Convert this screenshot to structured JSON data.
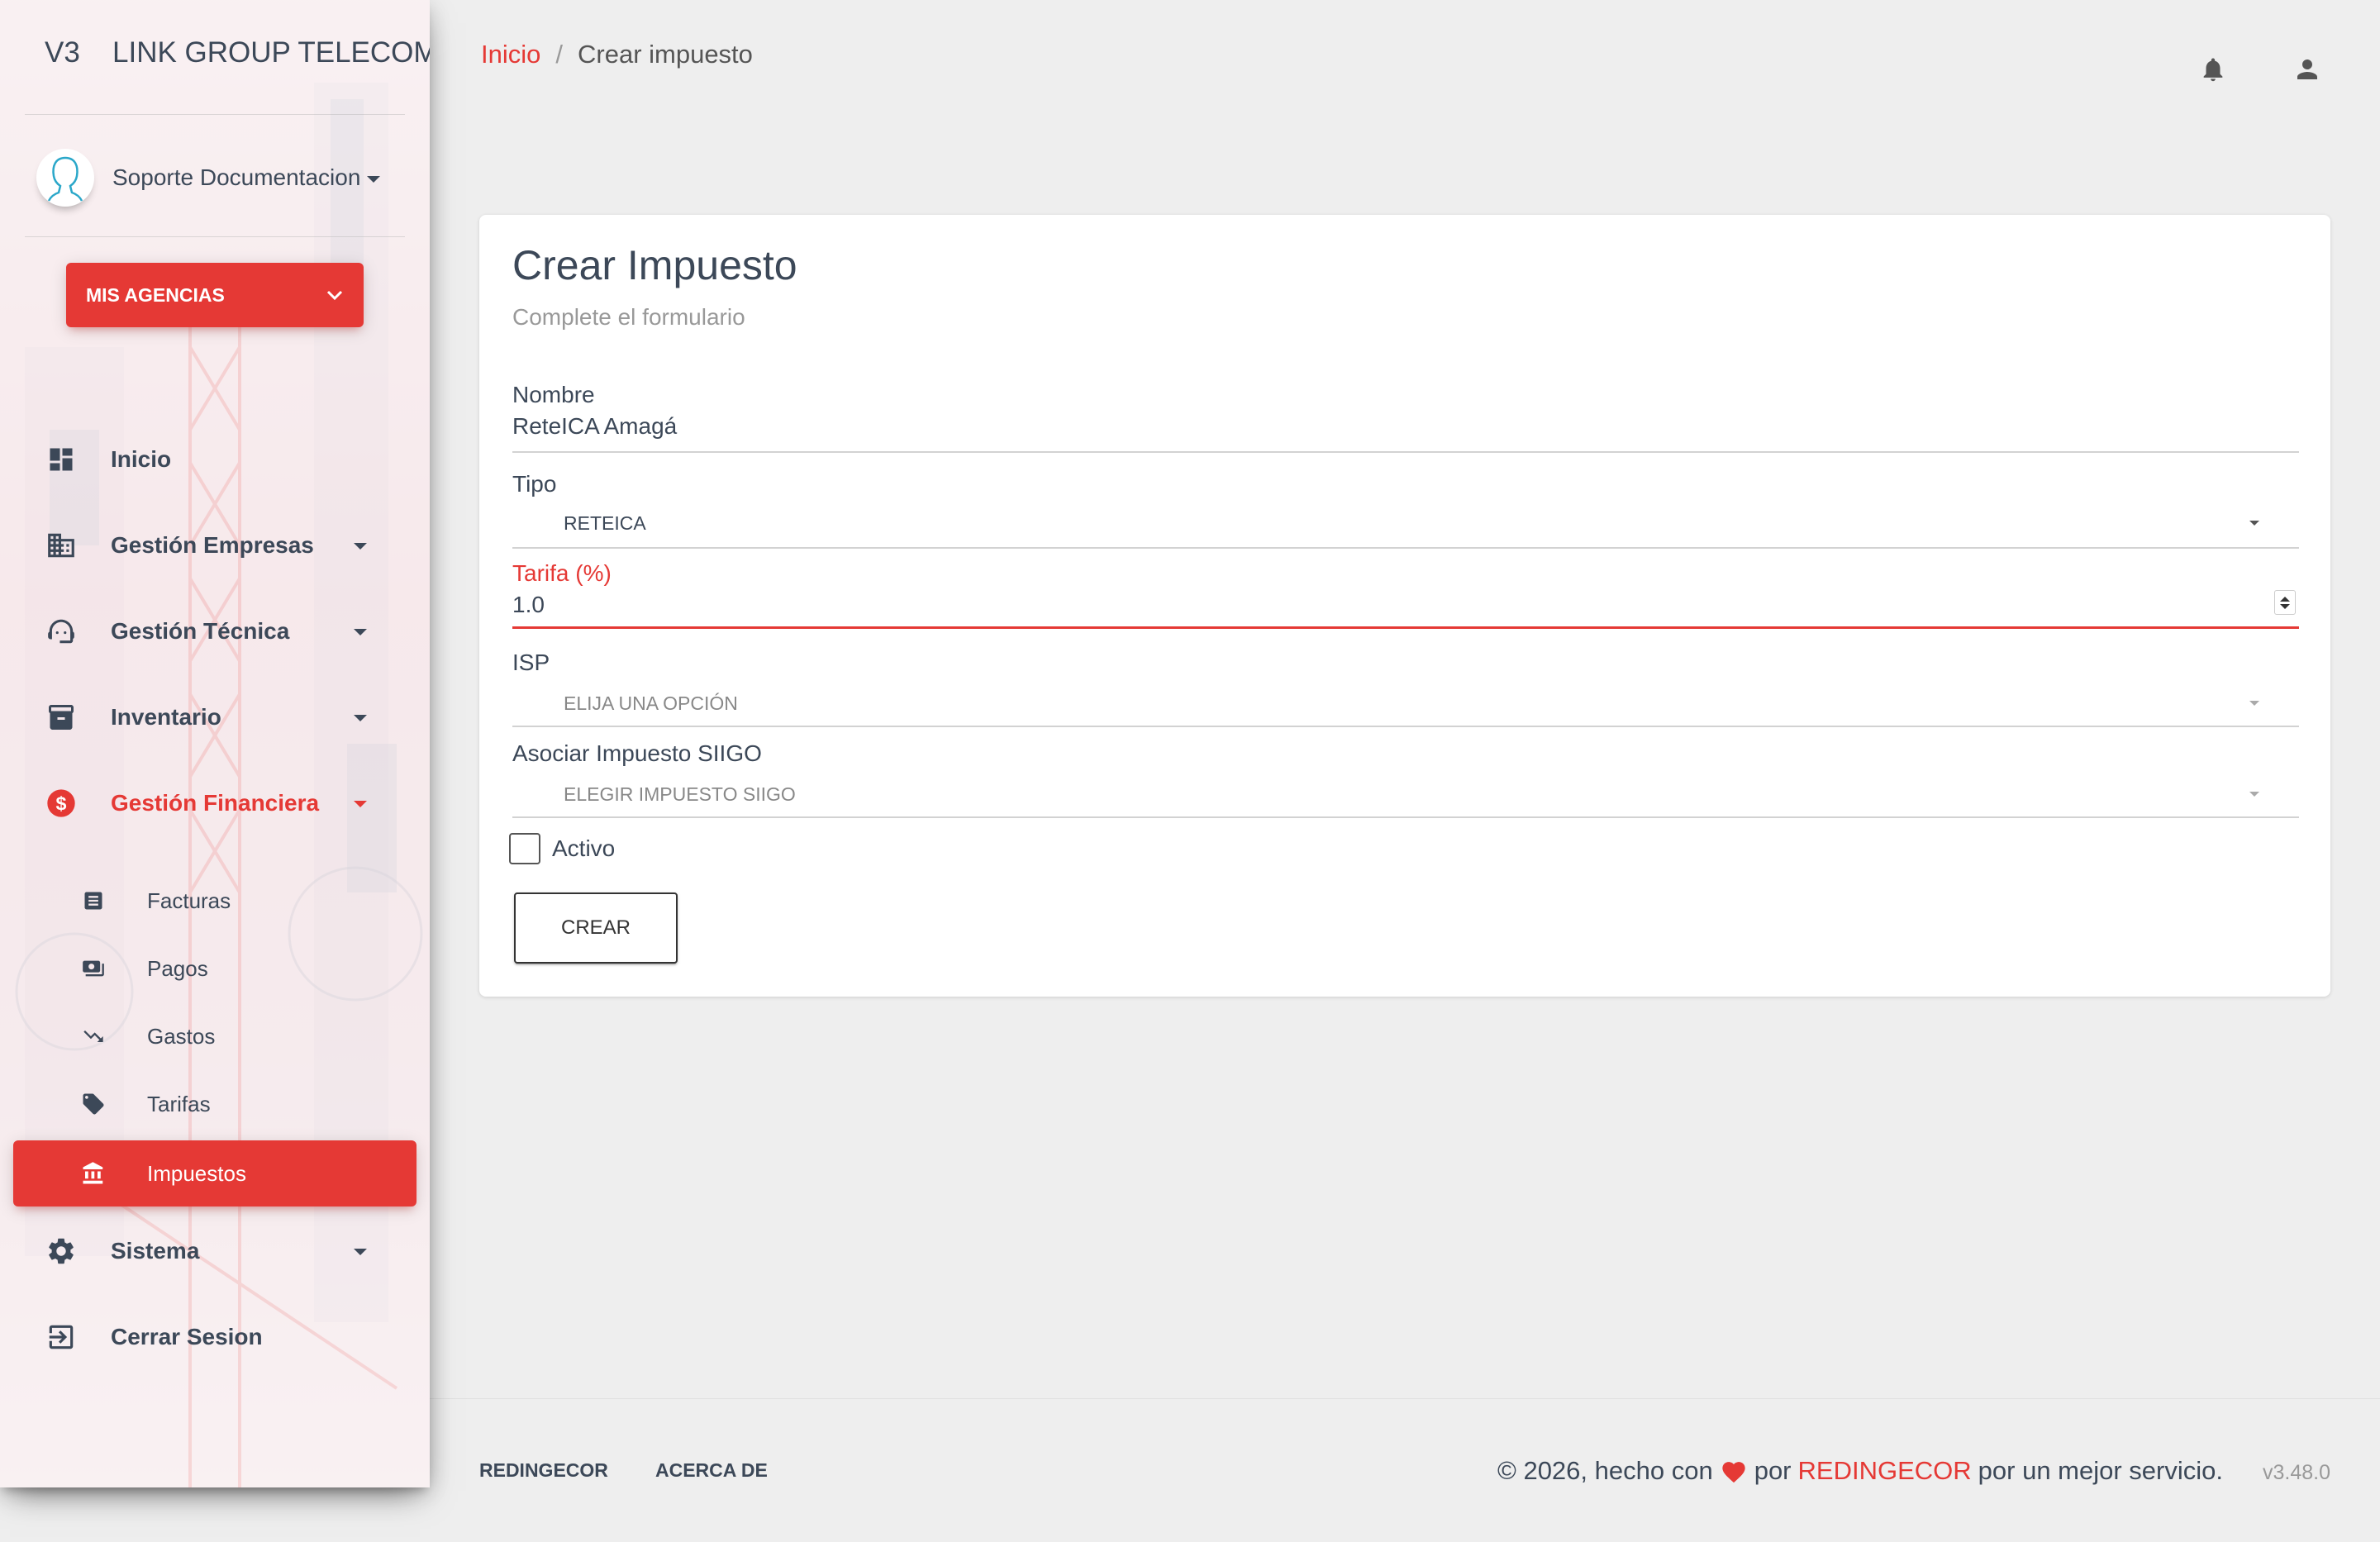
{
  "sidebar": {
    "logo_mini": "V3",
    "logo_text": "LINK GROUP TELECOMUNICACIONES",
    "user_name": "Soporte Documentacion",
    "agency_button": "MIS AGENCIAS",
    "nav": {
      "inicio": "Inicio",
      "empresas": "Gestión Empresas",
      "tecnica": "Gestión Técnica",
      "inventario": "Inventario",
      "financiera": "Gestión Financiera",
      "sistema": "Sistema",
      "logout": "Cerrar Sesion"
    },
    "sub": {
      "facturas": "Facturas",
      "pagos": "Pagos",
      "gastos": "Gastos",
      "tarifas": "Tarifas",
      "impuestos": "Impuestos"
    }
  },
  "breadcrumb": {
    "home": "Inicio",
    "separator": "/",
    "current": "Crear impuesto"
  },
  "form": {
    "title": "Crear Impuesto",
    "subtitle": "Complete el formulario",
    "nombre_label": "Nombre",
    "nombre_value": "ReteICA Amagá",
    "tipo_label": "Tipo",
    "tipo_value": "RETEICA",
    "tarifa_label": "Tarifa (%)",
    "tarifa_value": "1.0",
    "isp_label": "ISP",
    "isp_placeholder": "ELIJA UNA OPCIÓN",
    "siigo_label": "Asociar Impuesto SIIGO",
    "siigo_placeholder": "ELEGIR IMPUESTO SIIGO",
    "activo_label": "Activo",
    "submit_label": "CREAR"
  },
  "footer": {
    "link1": "REDINGECOR",
    "link2": "ACERCA DE",
    "copy_prefix": "© 2026, hecho con",
    "copy_por": "por",
    "brand": "REDINGECOR",
    "copy_suffix": "por un mejor servicio.",
    "version": "v3.48.0"
  },
  "colors": {
    "accent": "#e53935",
    "text": "#3c4858",
    "background": "#eeeeee"
  },
  "icons": [
    "dashboard-icon",
    "building-icon",
    "support-agent-icon",
    "archive-icon",
    "dollar-icon",
    "receipt-icon",
    "payments-icon",
    "trending-down-icon",
    "tag-icon",
    "bank-icon",
    "gear-icon",
    "logout-icon",
    "bell-icon",
    "person-icon",
    "avatar-icon",
    "heart-icon"
  ]
}
